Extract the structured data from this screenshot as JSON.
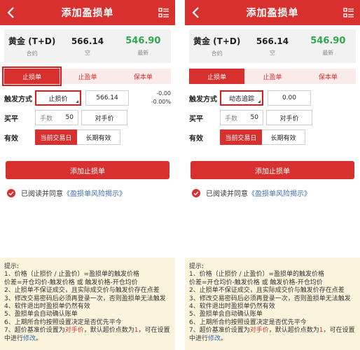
{
  "header": {
    "title": "添加盈损单"
  },
  "quote": {
    "name": "黄金 (T+D)",
    "name_label": "合约",
    "side": "566.14",
    "side_label": "空",
    "latest": "546.90",
    "latest_label": "最新"
  },
  "tabs": [
    "止损单",
    "止盈单",
    "保本单"
  ],
  "form": {
    "trigger_label": "触发方式",
    "close_label": "买平",
    "valid_label": "有效",
    "qty_label": "手数",
    "qty_value": "50",
    "counter_price": "对手价",
    "valid_current": "当前交易日",
    "valid_long": "长期有效"
  },
  "left": {
    "trigger_type": "止损价",
    "trigger_value": "566.14",
    "pct_top": "-0.00",
    "pct_bottom": "-0.00%"
  },
  "right": {
    "trigger_type": "动态追踪",
    "trigger_value": "0.00"
  },
  "add_button": "添加止损单",
  "agree": {
    "text": "已阅读并同意",
    "link": "《盈损单风险揭示》"
  },
  "tips": {
    "title": "提示:",
    "l1": "1、价格（止损价 / 止盈价）=盈损单的触发价格",
    "l2": "价差=开仓均价-触发价格 或 触发价格-开仓均价",
    "l3": "2、止损单不保证成交，且实际成交价与触发价存在点差",
    "l4": "3、修改交易密码后必须再登录一次，否则盈损单无法触发",
    "l5": "4、软件退出时盈损单仍然有效",
    "l6": "5、盈损单会自动确认账单",
    "l7": "6、上期所合约按照设置决定是否优先平今",
    "l8a": "7、超价基准价设置为",
    "l8b": "对手价",
    "l8c": "，默认超价点数为",
    "l8d": "1",
    "l8e": "，可在设置",
    "l9a": "中进行",
    "l9b": "修改",
    "l9c": "。"
  },
  "colors": {
    "brand": "#d8302f",
    "green": "#2fa84f",
    "tips_bg": "#fcf3dd",
    "link": "#3a6fb0"
  }
}
